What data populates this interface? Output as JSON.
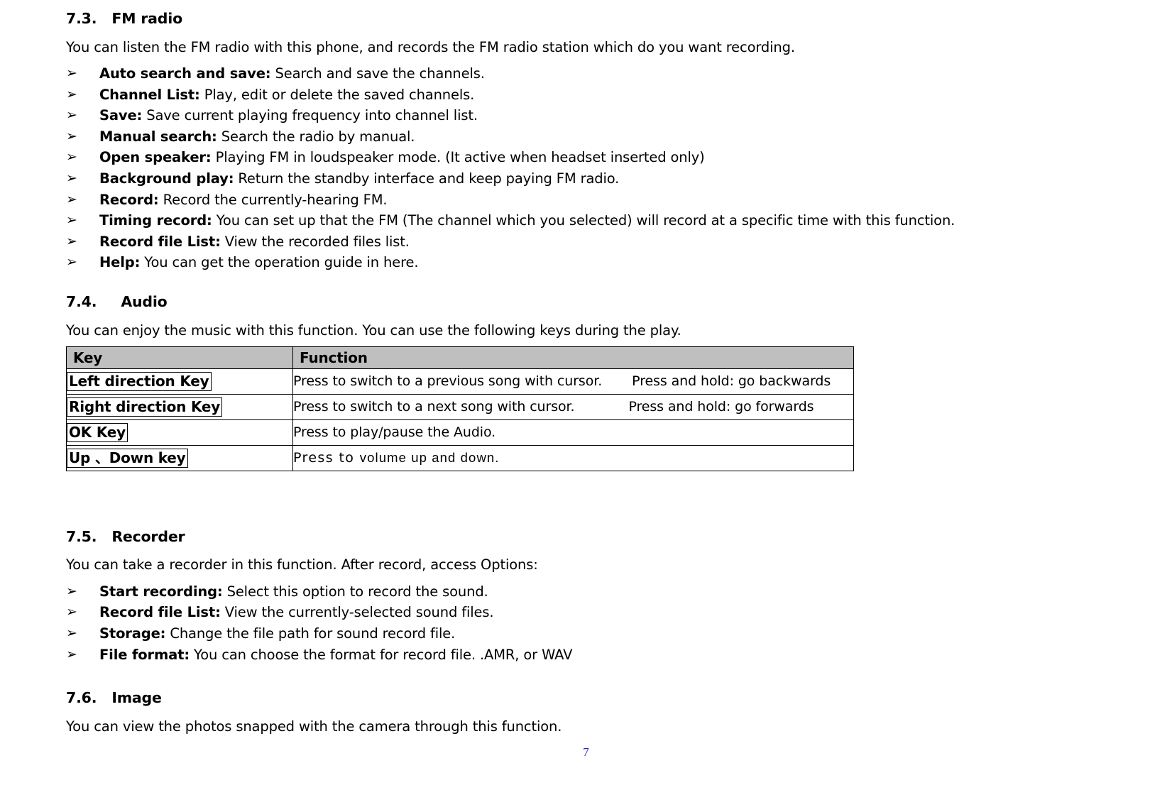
{
  "document": {
    "page_number": "7",
    "bullet_glyph": "➢"
  },
  "sections": [
    {
      "number": "7.3.",
      "title": "FM radio",
      "intro": "You can listen the FM radio with this phone, and records the FM radio station which do you want recording.",
      "items": [
        {
          "term": "Auto search and save:",
          "desc": " Search and save the channels."
        },
        {
          "term": "Channel List:",
          "desc": " Play, edit or delete the saved channels."
        },
        {
          "term": "Save:",
          "desc": " Save current playing frequency into channel list."
        },
        {
          "term": "Manual search:",
          "desc": " Search the radio by manual."
        },
        {
          "term": "Open speaker:",
          "desc": " Playing FM in loudspeaker mode. (It active when headset inserted only)"
        },
        {
          "term": "Background play:",
          "desc": " Return the standby interface and keep paying FM radio."
        },
        {
          "term": "Record:",
          "desc": " Record the currently-hearing FM."
        },
        {
          "term": "Timing record:",
          "desc": " You can set up that the FM (The channel which you selected) will record at a specific time with this function."
        },
        {
          "term": "Record file List:",
          "desc": " View the recorded files list."
        },
        {
          "term": "Help:",
          "desc": " You can get the operation guide in here."
        }
      ]
    },
    {
      "number": "7.4.",
      "title": "Audio",
      "intro": "You can enjoy the music with this function. You can use the following keys during the play."
    },
    {
      "number": "7.5.",
      "title": "Recorder",
      "intro": "You can take a recorder in this function. After record, access Options:",
      "items": [
        {
          "term": "Start recording:",
          "desc": " Select this option to record the sound."
        },
        {
          "term": "Record file List:",
          "desc": " View the currently-selected sound files."
        },
        {
          "term": "Storage:",
          "desc": " Change the file path for sound record file."
        },
        {
          "term": "File format:",
          "desc": " You can choose the format for record file. .AMR, or WAV"
        }
      ]
    },
    {
      "number": "7.6.",
      "title": "Image",
      "intro": "You can view the photos snapped with the camera through this function."
    }
  ],
  "audio_table": {
    "headers": [
      "Key",
      "Function"
    ],
    "rows": [
      {
        "key": "Left direction Key",
        "function_main": "Press to switch to a previous song with cursor.",
        "function_extra": "Press and hold: go backwards"
      },
      {
        "key": "Right direction Key",
        "function_main": "Press to switch to a next song with cursor.",
        "function_extra": "Press and hold: go forwards"
      },
      {
        "key": "OK Key",
        "function_main": "Press to play/pause the Audio.",
        "function_extra": ""
      },
      {
        "key": "Up 、Down key",
        "function_main": "Press to ",
        "function_extra": "volume up and down."
      }
    ],
    "header_background": "#bfbfbf"
  }
}
